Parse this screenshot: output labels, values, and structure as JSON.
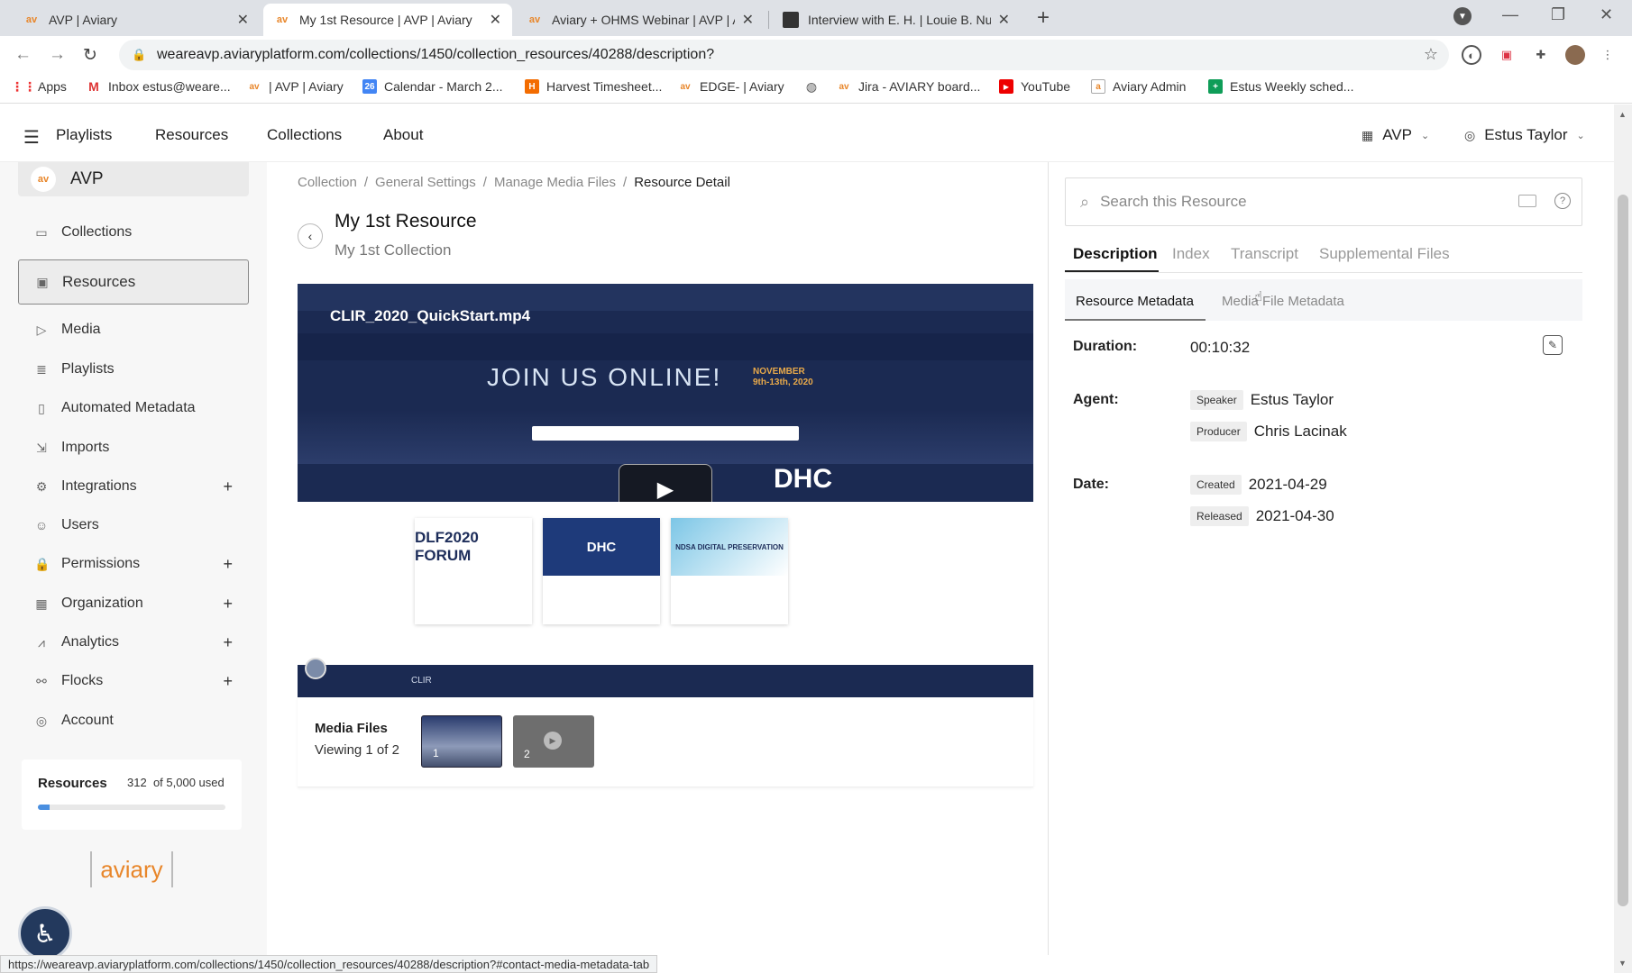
{
  "browser": {
    "tabs": [
      {
        "title": "AVP | Aviary",
        "favicon": "av"
      },
      {
        "title": "My 1st Resource | AVP | Aviary",
        "favicon": "av"
      },
      {
        "title": "Aviary + OHMS Webinar | AVP | A",
        "favicon": "av"
      },
      {
        "title": "Interview with E. H. | Louie B. Nu",
        "favicon": "img"
      }
    ],
    "url": "weareavp.aviaryplatform.com/collections/1450/collection_resources/40288/description?",
    "bookmarks": [
      "Apps",
      "Inbox estus@weare...",
      "| AVP | Aviary",
      "Calendar - March 2...",
      "Harvest Timesheet...",
      "EDGE- | Aviary",
      "Jira - AVIARY board...",
      "YouTube",
      "Aviary Admin",
      "Estus Weekly sched..."
    ],
    "status_url": "https://weareavp.aviaryplatform.com/collections/1450/collection_resources/40288/description?#contact-media-metadata-tab"
  },
  "header": {
    "nav": [
      "Playlists",
      "Resources",
      "Collections",
      "About"
    ],
    "org": "AVP",
    "user": "Estus Taylor"
  },
  "sidebar": {
    "org_name": "AVP",
    "items": [
      {
        "label": "Collections",
        "icon": "folder-icon"
      },
      {
        "label": "Resources",
        "icon": "resource-icon"
      },
      {
        "label": "Media",
        "icon": "media-icon"
      },
      {
        "label": "Playlists",
        "icon": "playlist-icon"
      },
      {
        "label": "Automated Metadata",
        "icon": "file-icon"
      },
      {
        "label": "Imports",
        "icon": "import-icon"
      },
      {
        "label": "Integrations",
        "icon": "gear-icon"
      },
      {
        "label": "Users",
        "icon": "users-icon"
      },
      {
        "label": "Permissions",
        "icon": "lock-icon"
      },
      {
        "label": "Organization",
        "icon": "building-icon"
      },
      {
        "label": "Analytics",
        "icon": "chart-icon"
      },
      {
        "label": "Flocks",
        "icon": "flock-icon"
      },
      {
        "label": "Account",
        "icon": "account-icon"
      }
    ],
    "resources_label": "Resources",
    "resources_used": "312",
    "resources_total": "of 5,000 used",
    "resources_fraction": 0.0624,
    "logo_text": "aviary"
  },
  "main": {
    "breadcrumbs": [
      "Collection",
      "General Settings",
      "Manage Media Files",
      "Resource Detail"
    ],
    "title": "My 1st Resource",
    "subtitle": "My 1st Collection",
    "video_filename": "CLIR_2020_QuickStart.mp4",
    "video_headline": "JOIN US ONLINE!",
    "video_date": "NOVEMBER 9th-13th, 2020",
    "video_dhc": "DHC",
    "card_labels": [
      "DLF2020 FORUM",
      "DHC",
      "NDSA DIGITAL PRESERVATION"
    ],
    "strip_label": "CLIR",
    "media_files_title": "Media Files",
    "media_files_viewing": "Viewing 1 of 2",
    "thumbs": [
      "1",
      "2"
    ]
  },
  "panel": {
    "search_placeholder": "Search this Resource",
    "tabs": [
      "Description",
      "Index",
      "Transcript",
      "Supplemental Files"
    ],
    "subtabs": [
      "Resource Metadata",
      "Media File Metadata"
    ],
    "metadata": {
      "duration_label": "Duration:",
      "duration_value": "00:10:32",
      "agent_label": "Agent:",
      "agents": [
        {
          "role": "Speaker",
          "name": "Estus Taylor"
        },
        {
          "role": "Producer",
          "name": "Chris Lacinak"
        }
      ],
      "date_label": "Date:",
      "dates": [
        {
          "type": "Created",
          "value": "2021-04-29"
        },
        {
          "type": "Released",
          "value": "2021-04-30"
        }
      ]
    }
  },
  "colors": {
    "accent_orange": "#e8862a",
    "progress_blue": "#4a8fe0",
    "video_navy": "#1b2a52"
  }
}
